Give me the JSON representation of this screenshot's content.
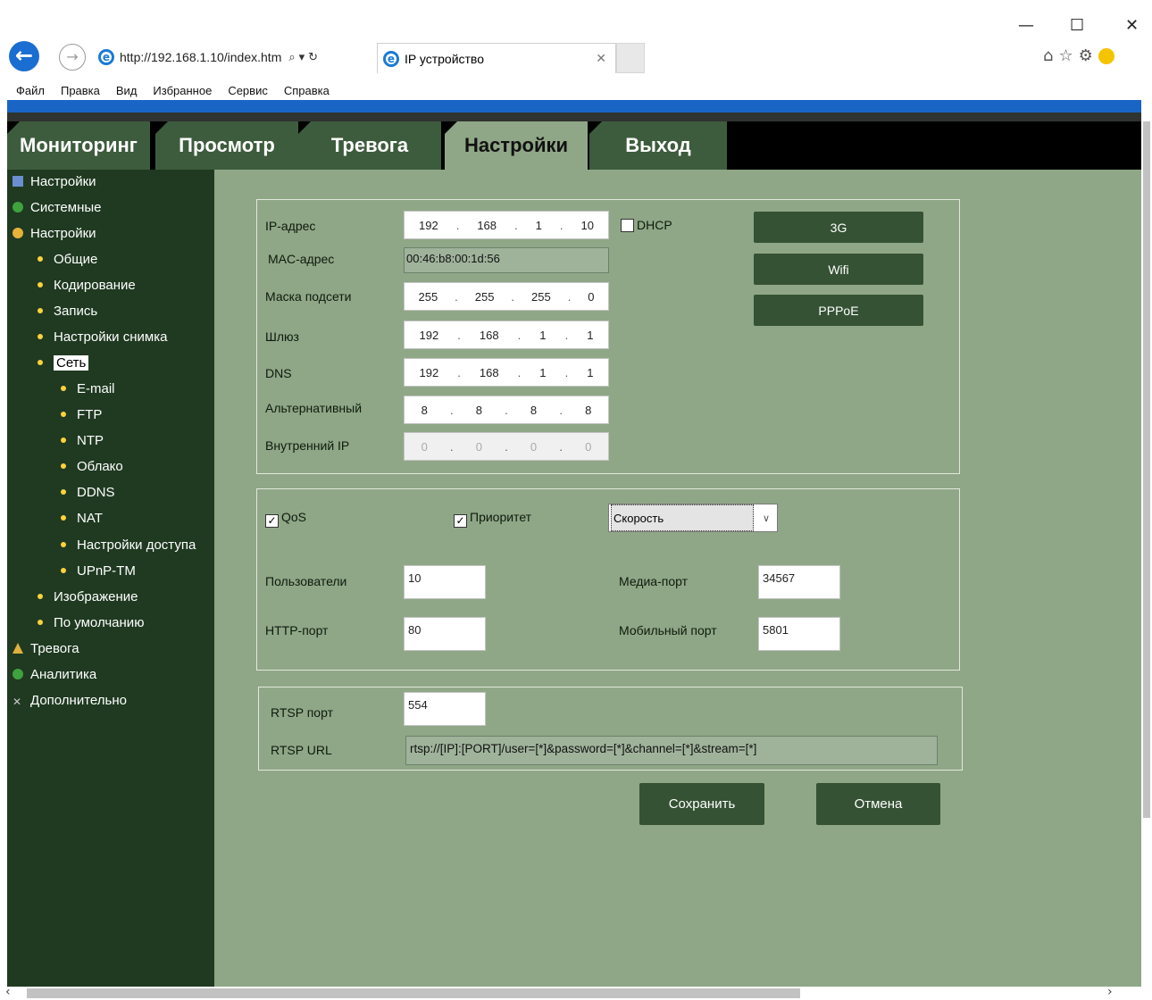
{
  "browser": {
    "url": "http://192.168.1.10/index.htm",
    "tab_title": "IP устройство",
    "menu": [
      "Файл",
      "Правка",
      "Вид",
      "Избранное",
      "Сервис",
      "Справка"
    ]
  },
  "nav": {
    "tabs": [
      "Мониторинг",
      "Просмотр",
      "Тревога",
      "Настройки",
      "Выход"
    ],
    "active": "Настройки"
  },
  "sidebar": {
    "top": [
      {
        "label": "Настройки",
        "icon": "monitor-icon"
      },
      {
        "label": "Системные",
        "icon": "info-icon"
      },
      {
        "label": "Настройки",
        "icon": "gear-icon"
      }
    ],
    "settings_items": [
      "Общие",
      "Кодирование",
      "Запись",
      "Настройки снимка",
      "Сеть"
    ],
    "network_items": [
      "E-mail",
      "FTP",
      "NTP",
      "Облако",
      "DDNS",
      "NAT",
      "Настройки доступа",
      "UPnP-TM"
    ],
    "after_items": [
      "Изображение",
      "По умолчанию"
    ],
    "bottom": [
      {
        "label": "Тревога",
        "icon": "bell-icon"
      },
      {
        "label": "Аналитика",
        "icon": "analytics-icon"
      },
      {
        "label": "Дополнительно",
        "icon": "tools-icon"
      }
    ],
    "selected": "Сеть"
  },
  "network": {
    "ip_label": "IP-адрес",
    "ip": [
      "192",
      "168",
      "1",
      "10"
    ],
    "dhcp_label": "DHCP",
    "dhcp_checked": false,
    "mac_label": "MAC-адрес",
    "mac": "00:46:b8:00:1d:56",
    "mask_label": "Маска подсети",
    "mask": [
      "255",
      "255",
      "255",
      "0"
    ],
    "gateway_label": "Шлюз",
    "gateway": [
      "192",
      "168",
      "1",
      "1"
    ],
    "dns_label": "DNS",
    "dns": [
      "192",
      "168",
      "1",
      "1"
    ],
    "alt_label": "Альтернативный",
    "alt": [
      "8",
      "8",
      "8",
      "8"
    ],
    "internal_label": "Внутренний IP",
    "internal": [
      "0",
      "0",
      "0",
      "0"
    ],
    "buttons": [
      "3G",
      "Wifi",
      "PPPoE"
    ]
  },
  "qos": {
    "qos_label": "QoS",
    "qos_checked": true,
    "priority_label": "Приоритет",
    "priority_checked": true,
    "priority_value": "Скорость",
    "users_label": "Пользователи",
    "users": "10",
    "media_label": "Медиа-порт",
    "media": "34567",
    "http_label": "HTTP-порт",
    "http": "80",
    "mobile_label": "Мобильный порт",
    "mobile": "5801"
  },
  "rtsp": {
    "port_label": "RTSP порт",
    "port": "554",
    "url_label": "RTSP URL",
    "url": "rtsp://[IP]:[PORT]/user=[*]&password=[*]&channel=[*]&stream=[*]"
  },
  "actions": {
    "save": "Сохранить",
    "cancel": "Отмена"
  },
  "colors": {
    "accent": "#1865c6",
    "page_bg": "#8fa786",
    "sidebar_bg": "#1f3a21",
    "button": "#355234"
  }
}
